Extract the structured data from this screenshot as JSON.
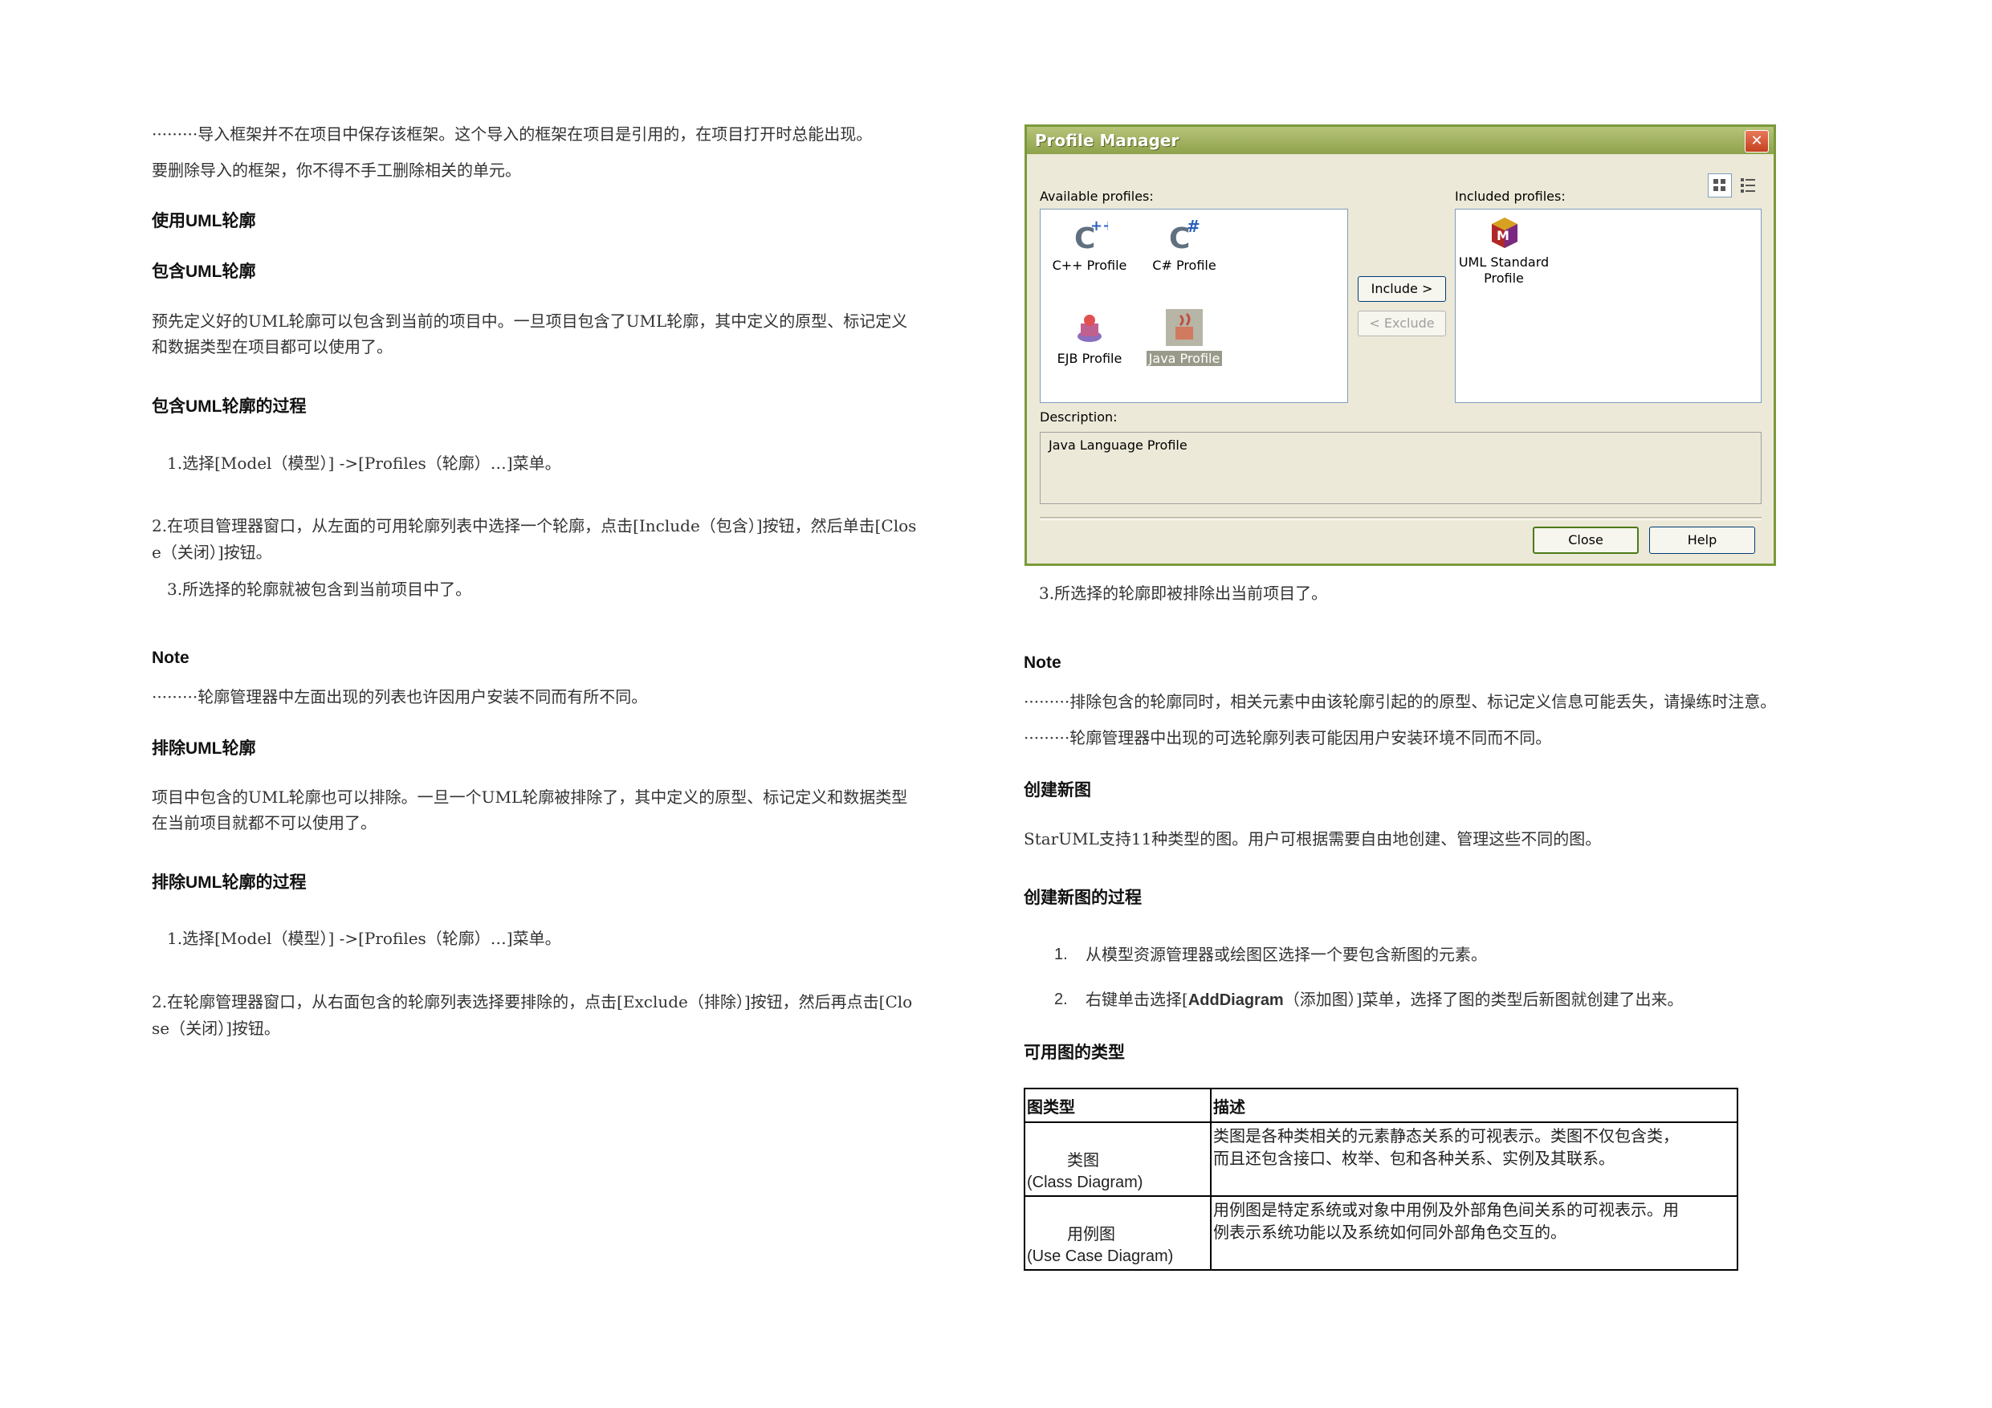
{
  "left": {
    "intro1": "·········导入框架并不在项目中保存该框架。这个导入的框架在项目是引用的，在项目打开时总能出现。",
    "intro2": "要删除导入的框架，你不得不手工删除相关的单元。",
    "h_use": "使用UML轮廓",
    "h_include": "包含UML轮廓",
    "include_para_line1": "预先定义好的UML轮廓可以包含到当前的项目中。一旦项目包含了UML轮廓，其中定义的原型、标记定义",
    "include_para_line2": "和数据类型在项目都可以使用了。",
    "h_include_proc": "包含UML轮廓的过程",
    "inc_step1": "1.选择[Model（模型）] ->[Profiles（轮廓）…]菜单。",
    "inc_step2_line1": "2.在项目管理器窗口，从左面的可用轮廓列表中选择一个轮廓，点击[Include（包含）]按钮，然后单击[Clos",
    "inc_step2_line2": "e（关闭）]按钮。",
    "inc_step3": "3.所选择的轮廓就被包含到当前项目中了。",
    "note_label": "Note",
    "note_text": "·········轮廓管理器中左面出现的列表也许因用户安装不同而有所不同。",
    "h_exclude": "排除UML轮廓",
    "exclude_para_line1": "项目中包含的UML轮廓也可以排除。一旦一个UML轮廓被排除了，其中定义的原型、标记定义和数据类型",
    "exclude_para_line2": "在当前项目就都不可以使用了。",
    "h_exclude_proc": "排除UML轮廓的过程",
    "exc_step1": "1.选择[Model（模型）] ->[Profiles（轮廓）…]菜单。",
    "exc_step2_line1": "2.在轮廓管理器窗口，从右面包含的轮廓列表选择要排除的，点击[Exclude（排除）]按钮，然后再点击[Clo",
    "exc_step2_line2": "se（关闭）]按钮。"
  },
  "dialog": {
    "title": "Profile Manager",
    "available_label": "Available profiles:",
    "included_label": "Included profiles:",
    "available": [
      {
        "icon": "cpp-profile-icon",
        "label": "C++ Profile"
      },
      {
        "icon": "csharp-profile-icon",
        "label": "C# Profile"
      },
      {
        "icon": "ejb-profile-icon",
        "label": "EJB Profile"
      },
      {
        "icon": "java-profile-icon",
        "label": "Java Profile",
        "selected": true
      }
    ],
    "included": [
      {
        "icon": "uml-standard-profile-icon",
        "label_line1": "UML Standard",
        "label_line2": "Profile"
      }
    ],
    "include_button": "Include >",
    "exclude_button": "< Exclude",
    "description_label": "Description:",
    "description_text": "Java Language Profile",
    "close_button": "Close",
    "help_button": "Help"
  },
  "right": {
    "step3": "3.所选择的轮廓即被排除出当前项目了。",
    "note_label": "Note",
    "note1": "·········排除包含的轮廓同时，相关元素中由该轮廓引起的的原型、标记定义信息可能丢失，请操练时注意。",
    "note2": "·········轮廓管理器中出现的可选轮廓列表可能因用户安装环境不同而不同。",
    "h_create": "创建新图",
    "create_para": "StarUML支持11种类型的图。用户可根据需要自由地创建、管理这些不同的图。",
    "h_create_proc": "创建新图的过程",
    "cstep1_num": "1.",
    "cstep1": "从模型资源管理器或绘图区选择一个要包含新图的元素。",
    "cstep2_num": "2.",
    "cstep2_a": "右键单击选择[",
    "cstep2_b": "AddDiagram",
    "cstep2_c": "（添加图）]菜单，选择了图的类型后新图就创建了出来。",
    "h_types": "可用图的类型",
    "table": {
      "col1": "图类型",
      "col2": "描述",
      "rows": [
        {
          "name_cn": "类图",
          "name_en": "(Class Diagram)",
          "desc_line1": "类图是各种类相关的元素静态关系的可视表示。类图不仅包含类，",
          "desc_line2": "而且还包含接口、枚举、包和各种关系、实例及其联系。"
        },
        {
          "name_cn": "用例图",
          "name_en": "(Use Case Diagram)",
          "desc_line1": "用例图是特定系统或对象中用例及外部角色间关系的可视表示。用",
          "desc_line2": "例表示系统功能以及系统如何同外部角色交互的。"
        }
      ]
    }
  }
}
